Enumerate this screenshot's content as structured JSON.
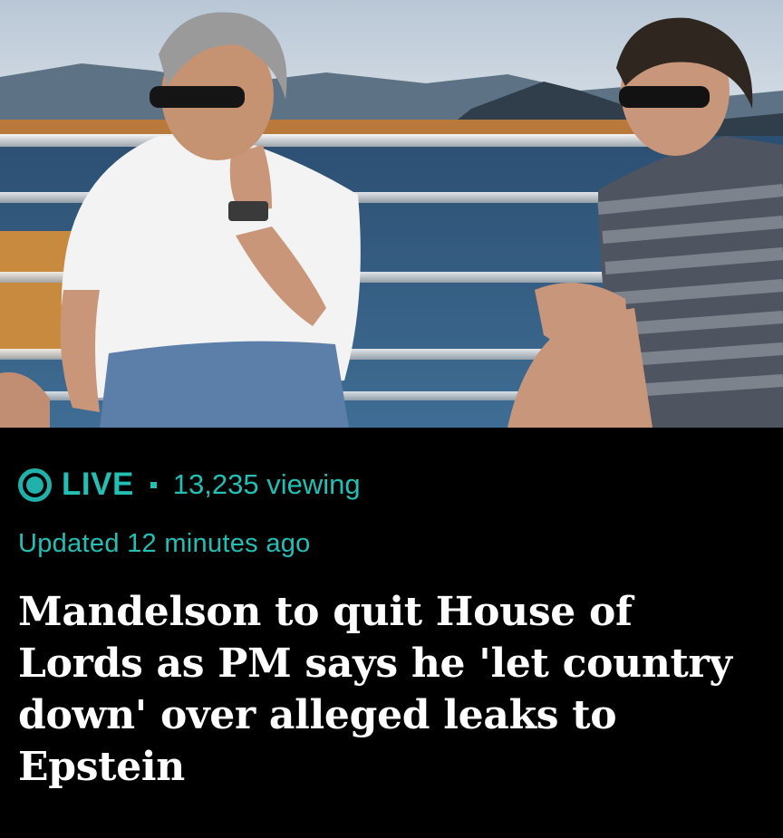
{
  "article": {
    "image": {
      "alt_icon": "photo-two-men-on-boat"
    },
    "live": {
      "label": "LIVE",
      "viewers": "13,235 viewing"
    },
    "updated": "Updated 12 minutes ago",
    "headline": "Mandelson to quit House of Lords as PM says he 'let country down' over alleged leaks to Epstein"
  },
  "colors": {
    "accent": "#23bfb5",
    "background": "#000000",
    "headline": "#ffffff"
  }
}
